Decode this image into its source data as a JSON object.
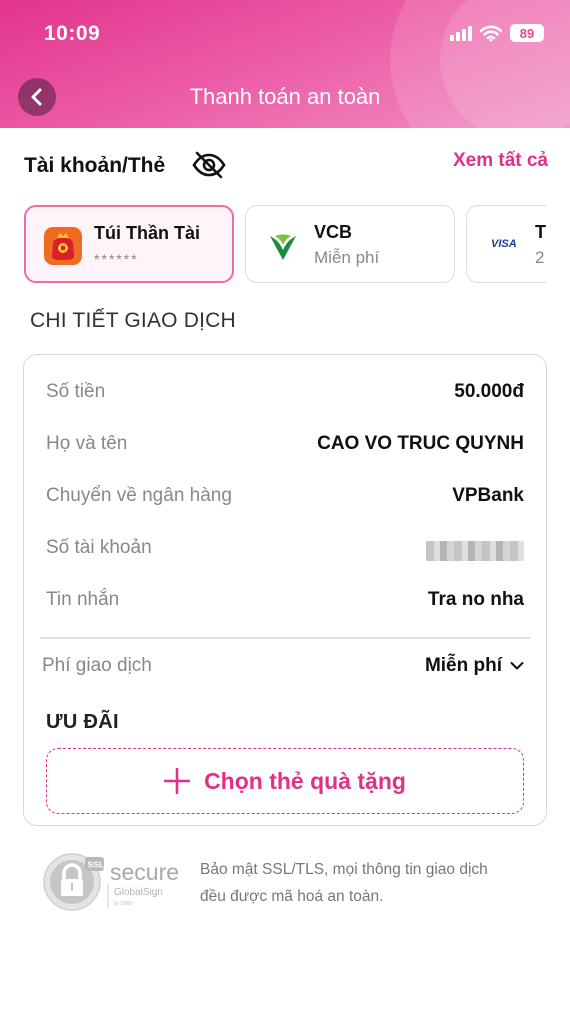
{
  "status_bar": {
    "time": "10:09",
    "battery": "89"
  },
  "nav": {
    "title": "Thanh toán an toàn"
  },
  "accounts": {
    "title": "Tài khoản/Thẻ",
    "see_all": "Xem tất cả",
    "cards": [
      {
        "name": "Túi Thần Tài",
        "sub": "******",
        "selected": true
      },
      {
        "name": "VCB",
        "sub": "Miễn phí",
        "selected": false
      },
      {
        "name": "T",
        "sub": "2",
        "selected": false
      }
    ]
  },
  "details": {
    "title": "CHI TIẾT GIAO DỊCH",
    "rows": [
      {
        "label": "Số tiền",
        "value": "50.000đ"
      },
      {
        "label": "Họ và tên",
        "value": "CAO VO TRUC QUYNH"
      },
      {
        "label": "Chuyển về ngân hàng",
        "value": "VPBank"
      },
      {
        "label": "Số tài khoản",
        "value": ""
      },
      {
        "label": "Tin nhắn",
        "value": "Tra no nha"
      }
    ],
    "fee": {
      "label": "Phí giao dịch",
      "value": "Miễn phí"
    }
  },
  "offers": {
    "title": "ƯU ĐÃI",
    "gift_button": "Chọn thẻ quà tặng"
  },
  "security": {
    "seal_ssl": "SSL",
    "seal_secure": "secure",
    "seal_globalsign": "GlobalSign",
    "seal_gmo": "by GMO",
    "text_line1": "Bảo mật SSL/TLS, mọi thông tin giao dịch",
    "text_line2": "đều được mã hoá an toàn."
  },
  "colors": {
    "brand": "#e0318a",
    "selected_border": "#f06aa8"
  }
}
